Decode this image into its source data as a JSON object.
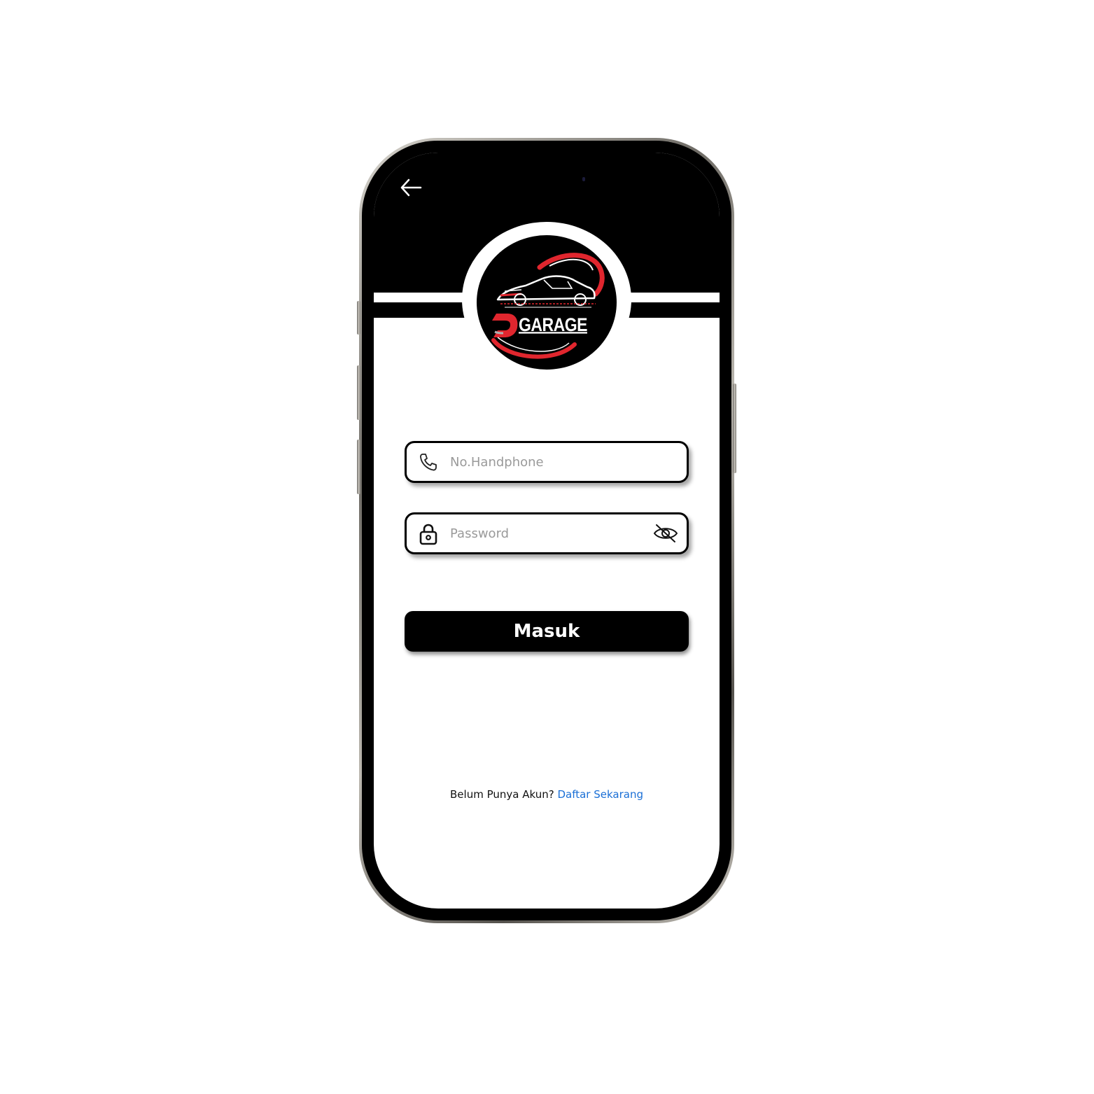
{
  "app": {
    "brand_name": "GARAGE",
    "colors": {
      "primary": "#000000",
      "accent_red": "#e0262e",
      "link": "#1a6fd6",
      "background": "#ffffff"
    }
  },
  "header": {
    "back_icon": "arrow-left-icon"
  },
  "form": {
    "phone": {
      "placeholder": "No.Handphone",
      "value": "",
      "icon": "phone-icon"
    },
    "password": {
      "placeholder": "Password",
      "value": "",
      "icon": "lock-icon",
      "toggle_icon": "eye-off-icon"
    },
    "submit_label": "Masuk"
  },
  "footer": {
    "prompt": "Belum Punya Akun?",
    "link_label": "Daftar Sekarang"
  }
}
